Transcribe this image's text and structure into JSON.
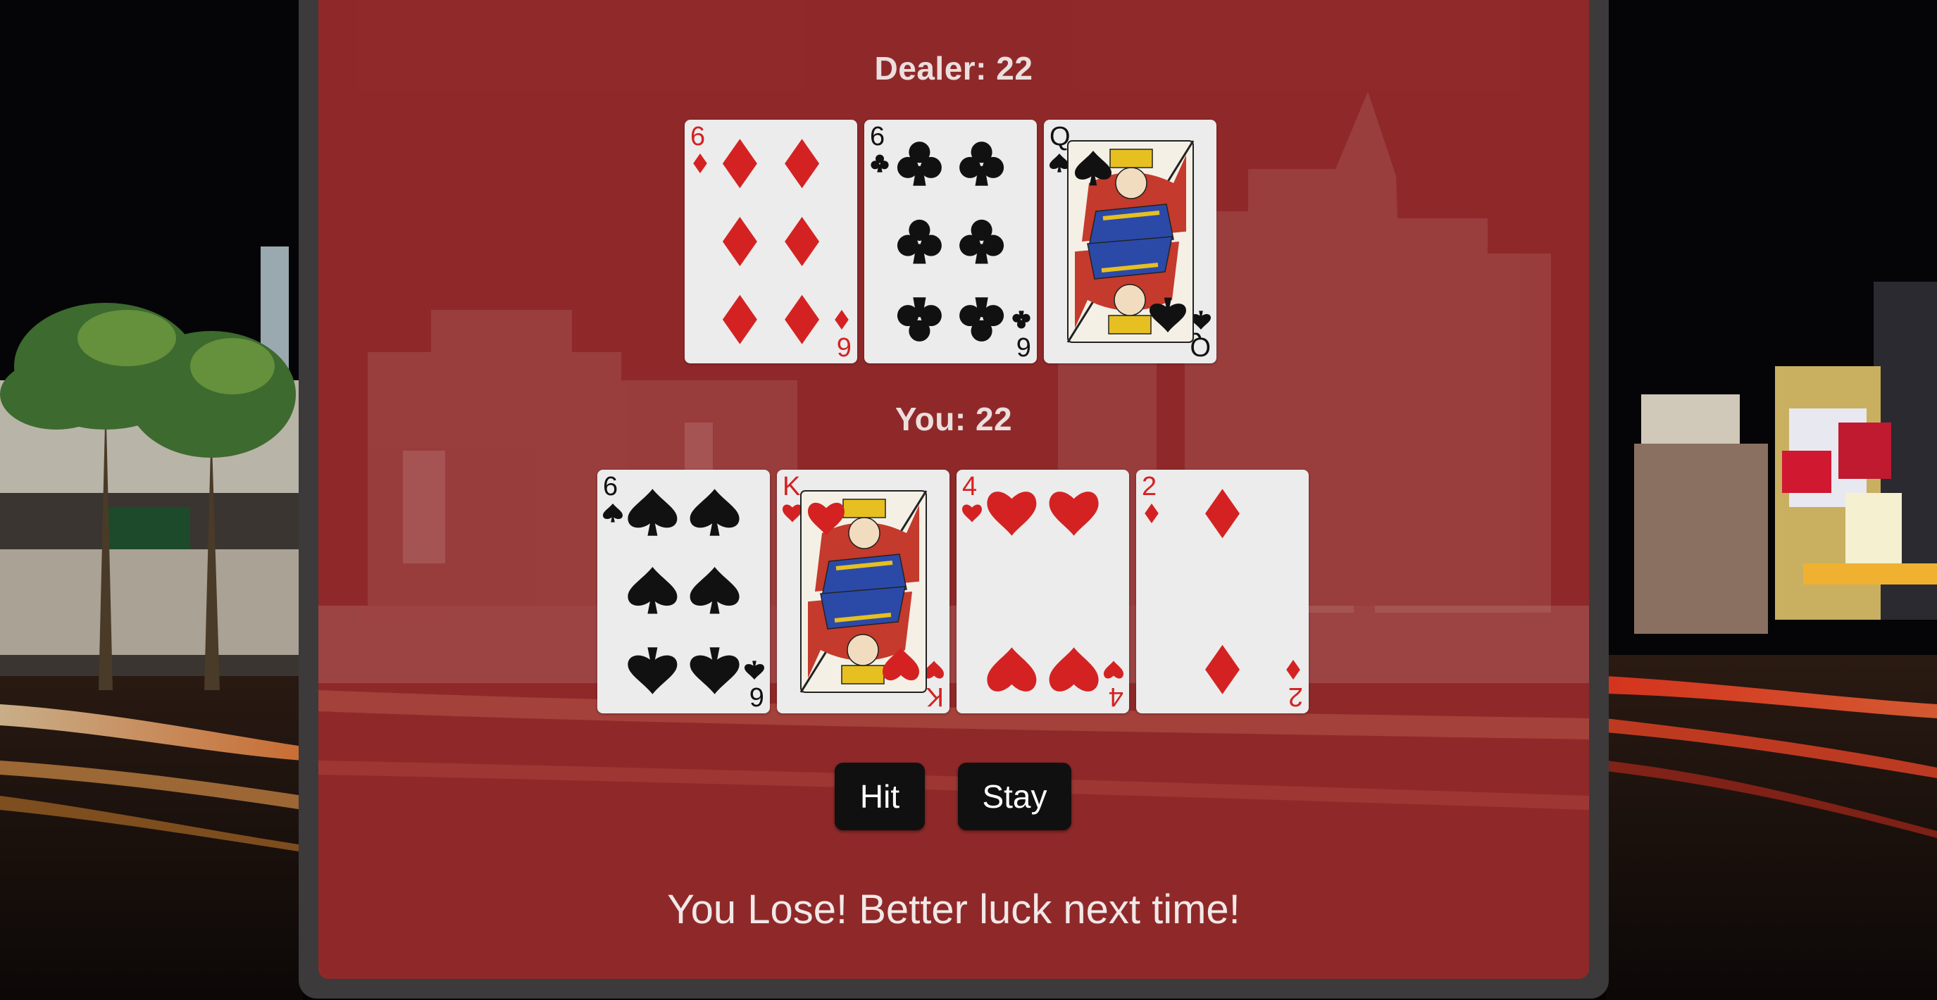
{
  "dealer": {
    "score_label": "Dealer: 22",
    "cards": [
      {
        "rank": "6",
        "suit": "diamonds",
        "face": "six-of-diamonds"
      },
      {
        "rank": "6",
        "suit": "clubs",
        "face": "six-of-clubs"
      },
      {
        "rank": "Q",
        "suit": "spades",
        "face": "queen-of-spades"
      }
    ]
  },
  "player": {
    "score_label": "You: 22",
    "cards": [
      {
        "rank": "6",
        "suit": "spades",
        "face": "six-of-spades"
      },
      {
        "rank": "K",
        "suit": "hearts",
        "face": "king-of-hearts"
      },
      {
        "rank": "4",
        "suit": "hearts",
        "face": "four-of-hearts"
      },
      {
        "rank": "2",
        "suit": "diamonds",
        "face": "two-of-diamonds"
      }
    ]
  },
  "controls": {
    "hit_label": "Hit",
    "stay_label": "Stay"
  },
  "result_message": "You Lose! Better luck next time!",
  "colors": {
    "panel": "#a02626",
    "button": "#101010",
    "suit_red": "#d42222",
    "suit_black": "#111111"
  }
}
